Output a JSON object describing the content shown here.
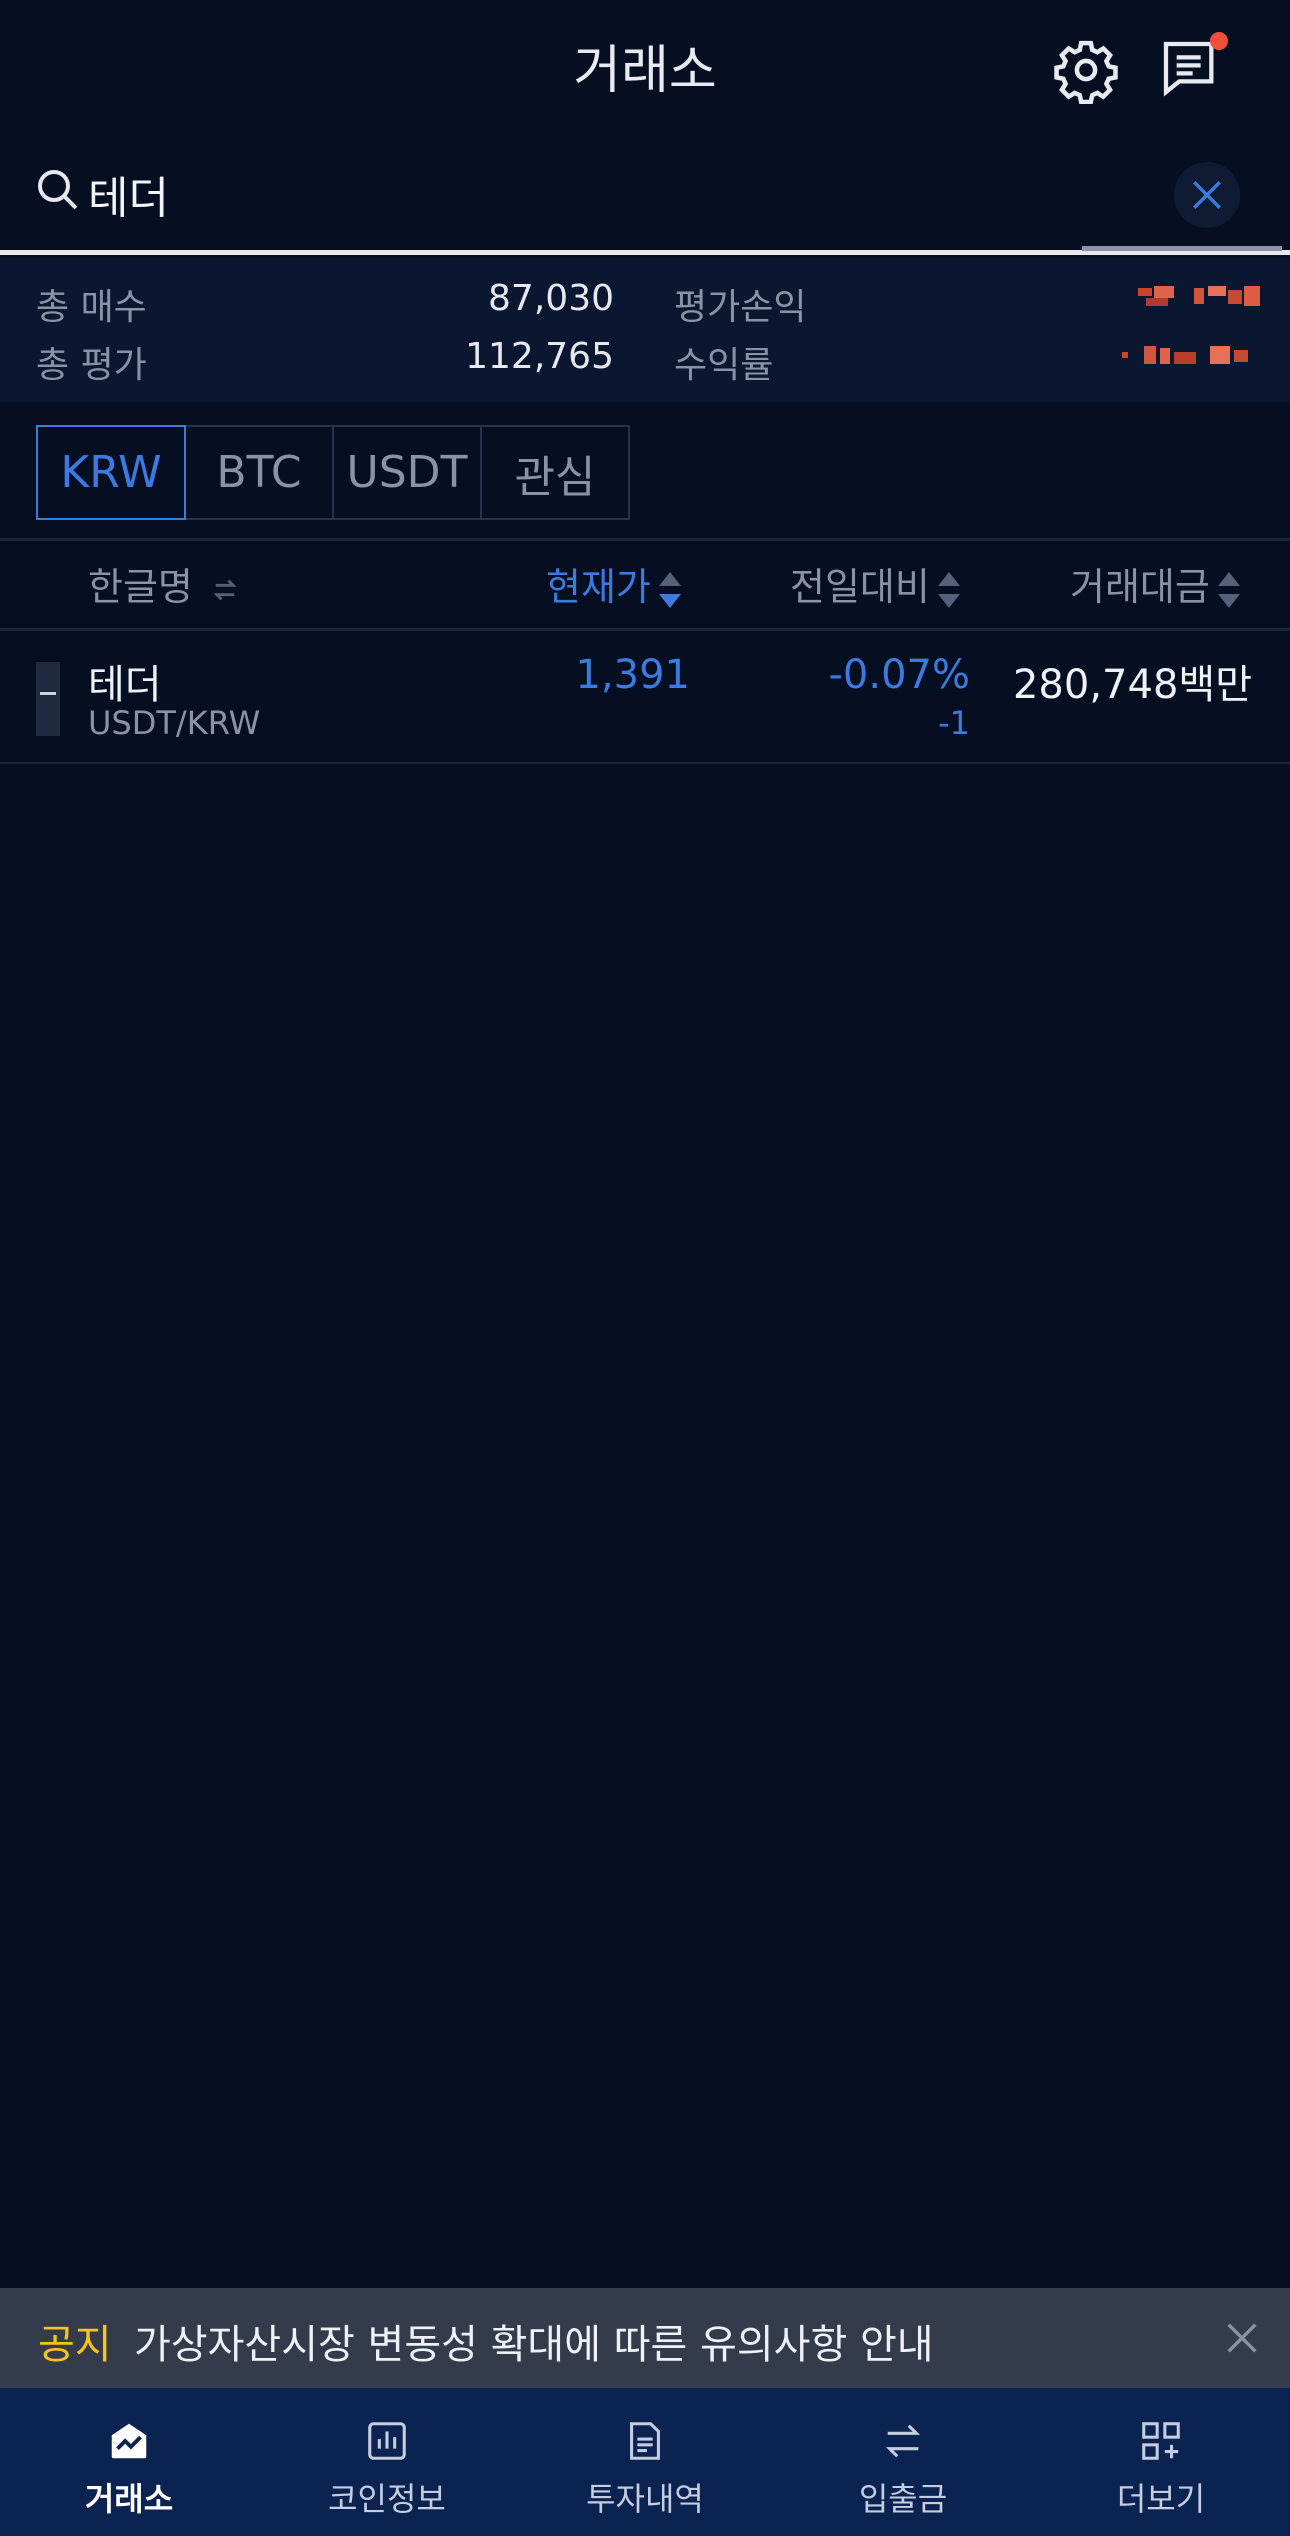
{
  "header": {
    "title": "거래소"
  },
  "search": {
    "query": "테더"
  },
  "summary": {
    "total_buy_label": "총 매수",
    "total_buy_value": "87,030",
    "total_eval_label": "총 평가",
    "total_eval_value": "112,765",
    "pnl_label": "평가손익",
    "return_label": "수익률"
  },
  "tabs": [
    {
      "label": "KRW",
      "active": true
    },
    {
      "label": "BTC",
      "active": false
    },
    {
      "label": "USDT",
      "active": false
    },
    {
      "label": "관심",
      "active": false
    }
  ],
  "columns": {
    "name": "한글명",
    "price": "현재가",
    "change": "전일대비",
    "volume": "거래대금"
  },
  "rows": [
    {
      "name": "테더",
      "pair": "USDT/KRW",
      "price": "1,391",
      "change_pct": "-0.07%",
      "change_abs": "-1",
      "volume": "280,748백만"
    }
  ],
  "notice": {
    "tag": "공지",
    "text": "가상자산시장 변동성 확대에 따른 유의사항 안내"
  },
  "nav": [
    {
      "label": "거래소",
      "icon": "exchange-icon",
      "active": true
    },
    {
      "label": "코인정보",
      "icon": "chart-icon",
      "active": false
    },
    {
      "label": "투자내역",
      "icon": "document-icon",
      "active": false
    },
    {
      "label": "입출금",
      "icon": "transfer-icon",
      "active": false
    },
    {
      "label": "더보기",
      "icon": "more-grid-icon",
      "active": false
    }
  ],
  "colors": {
    "background": "#060f22",
    "accent_blue": "#3b7bdf",
    "notice_yellow": "#f5c518",
    "navbar": "#0b2350",
    "badge_red": "#f0503a"
  }
}
